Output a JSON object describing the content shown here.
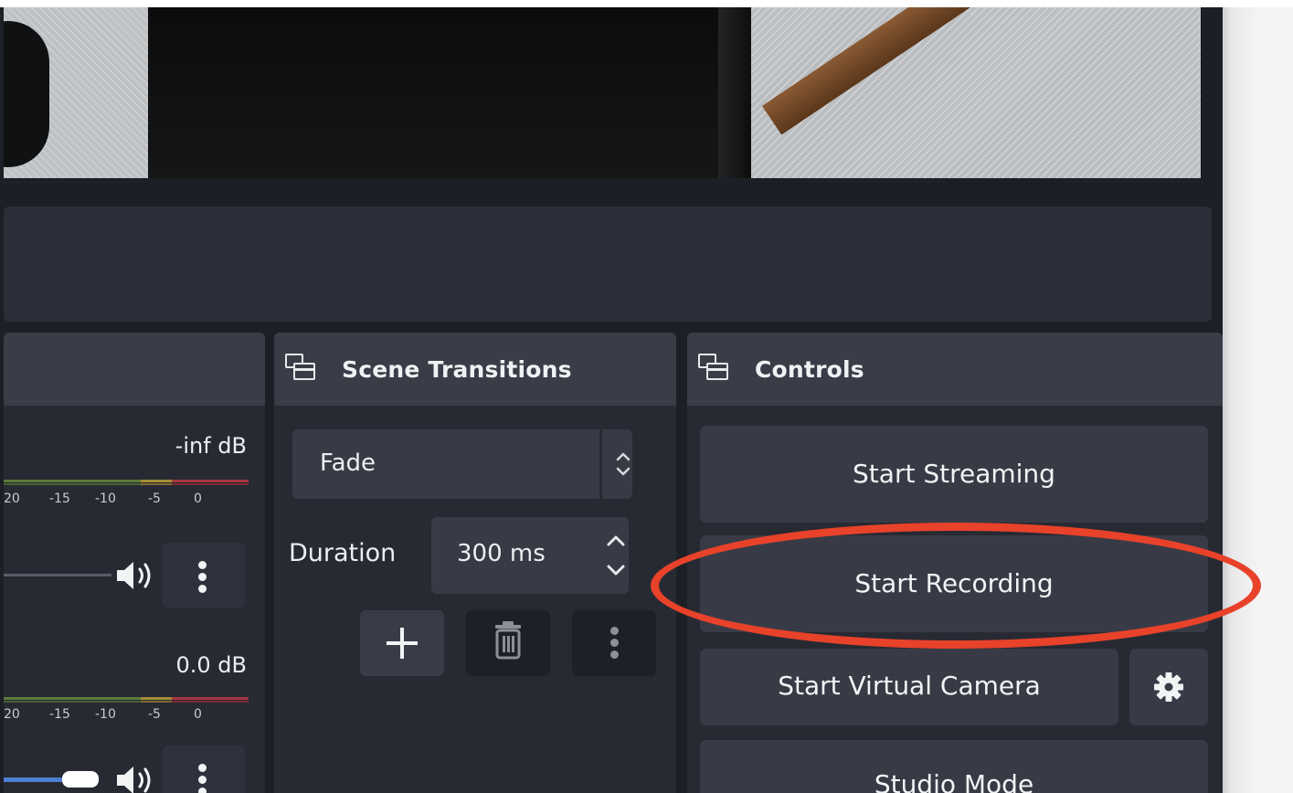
{
  "mixer": {
    "channels": [
      {
        "db": "-inf dB",
        "scale": [
          "20",
          "-15",
          "-10",
          "-5",
          "0"
        ]
      },
      {
        "db": "0.0 dB",
        "scale": [
          "20",
          "-15",
          "-10",
          "-5",
          "0"
        ]
      }
    ]
  },
  "transitions": {
    "title": "Scene Transitions",
    "selected": "Fade",
    "duration_label": "Duration",
    "duration_value": "300 ms"
  },
  "controls": {
    "title": "Controls",
    "start_streaming": "Start Streaming",
    "start_recording": "Start Recording",
    "start_virtual_camera": "Start Virtual Camera",
    "studio_mode": "Studio Mode"
  },
  "colors": {
    "annotation": "#e8422a",
    "panel_bg": "#272a33",
    "header_bg": "#3a3d48",
    "button_bg": "#383b46",
    "fader_blue": "#4b7fd1"
  },
  "icons": {
    "dock": "dock-window-icon",
    "speaker": "speaker-icon",
    "kebab": "kebab-menu-icon",
    "plus": "plus-icon",
    "trash": "trash-icon",
    "gear": "gear-icon",
    "updown": "chevron-updown-icon"
  }
}
